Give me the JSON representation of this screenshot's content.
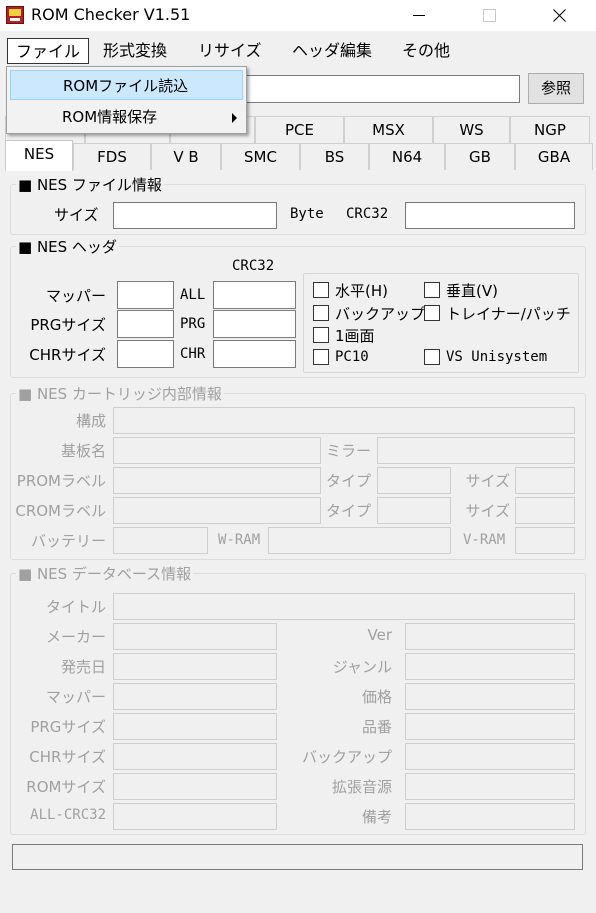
{
  "window": {
    "title": "ROM Checker V1.51"
  },
  "menubar": {
    "items": [
      "ファイル",
      "形式変換",
      "リサイズ",
      "ヘッダ編集",
      "その他"
    ]
  },
  "file_menu": {
    "items": [
      "ROMファイル読込",
      "ROM情報保存"
    ]
  },
  "toolbar": {
    "browse_label": "参照"
  },
  "tabs": {
    "row1": [
      "",
      "",
      "",
      "PCE",
      "MSX",
      "WS",
      "NGP"
    ],
    "row2": [
      "NES",
      "FDS",
      "V B",
      "SMC",
      "BS",
      "N64",
      "GB",
      "GBA"
    ],
    "selected": "NES"
  },
  "file_info": {
    "legend": "■ NES ファイル情報",
    "size_label": "サイズ",
    "byte_label": "Byte",
    "crc_label": "CRC32"
  },
  "header": {
    "legend": "■ NES ヘッダ",
    "crc_label": "CRC32",
    "mapper_label": "マッパー",
    "prg_size_label": "PRGサイズ",
    "chr_size_label": "CHRサイズ",
    "all_label": "ALL",
    "prg_label": "PRG",
    "chr_label": "CHR",
    "checkboxes": {
      "horizontal": "水平(H)",
      "vertical": "垂直(V)",
      "backup": "バックアップ",
      "trainer": "トレイナー/パッチ",
      "one_screen": "1画面",
      "pc10": "PC10",
      "vs": "VS Unisystem"
    }
  },
  "cart": {
    "legend": "■ NES カートリッジ内部情報",
    "composition": "構成",
    "board": "基板名",
    "mirror": "ミラー",
    "prom_label": "PROMラベル",
    "crom_label": "CROMラベル",
    "type": "タイプ",
    "size": "サイズ",
    "battery": "バッテリー",
    "wram": "W-RAM",
    "vram": "V-RAM"
  },
  "db": {
    "legend": "■ NES データベース情報",
    "title": "タイトル",
    "maker": "メーカー",
    "release": "発売日",
    "mapper": "マッパー",
    "prg_size": "PRGサイズ",
    "chr_size": "CHRサイズ",
    "rom_size": "ROMサイズ",
    "all_crc": "ALL-CRC32",
    "ver": "Ver",
    "genre": "ジャンル",
    "price": "価格",
    "part_no": "品番",
    "backup": "バックアップ",
    "ext_sound": "拡張音源",
    "notes": "備考"
  }
}
